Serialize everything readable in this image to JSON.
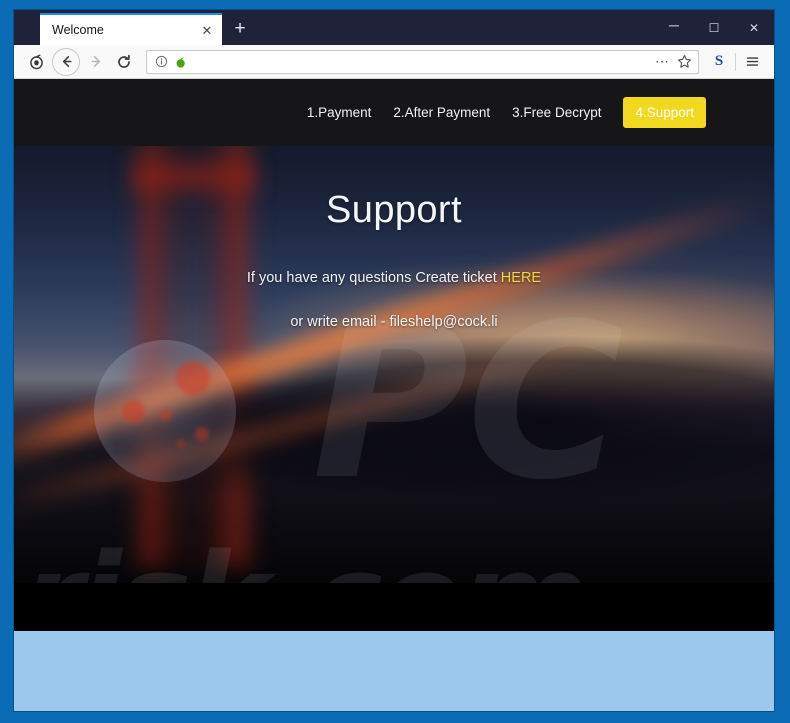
{
  "window": {
    "tabs": [
      {
        "title": "Welcome",
        "close_glyph": "✕",
        "active": true
      }
    ],
    "new_tab_glyph": "+",
    "controls": {
      "minimize": "─",
      "maximize": "☐",
      "close": "✕"
    }
  },
  "toolbar": {
    "onion_icon": "tor-onion-icon",
    "back_glyph": "←",
    "forward_glyph": "→",
    "reload_glyph": "⟳",
    "url_value": "",
    "url_placeholder": "",
    "info_glyph": "ⓘ",
    "ellipsis_glyph": "⋯",
    "star_glyph": "☆",
    "s_label": "S",
    "menu_glyph": "☰"
  },
  "site": {
    "nav": [
      {
        "label": "1.Payment",
        "active": false
      },
      {
        "label": "2.After Payment",
        "active": false
      },
      {
        "label": "3.Free Decrypt",
        "active": false
      },
      {
        "label": "4.Support",
        "active": true
      }
    ],
    "hero": {
      "title": "Support",
      "line1_before": "If you have any questions Create ticket ",
      "line1_link": "HERE",
      "line2": "or write email - fileshelp@cock.li"
    },
    "watermark": {
      "top": "PC",
      "bottom": "risk.com"
    }
  },
  "colors": {
    "titlebar": "#20223c",
    "active_tab_border": "#1a8fe3",
    "nav_bar": "#161618",
    "accent_yellow": "#f2d81e",
    "link_yellow": "#ecd93e",
    "desktop": "#0b6cb5",
    "below_page": "#9cc8ec",
    "footer": "#000000"
  }
}
